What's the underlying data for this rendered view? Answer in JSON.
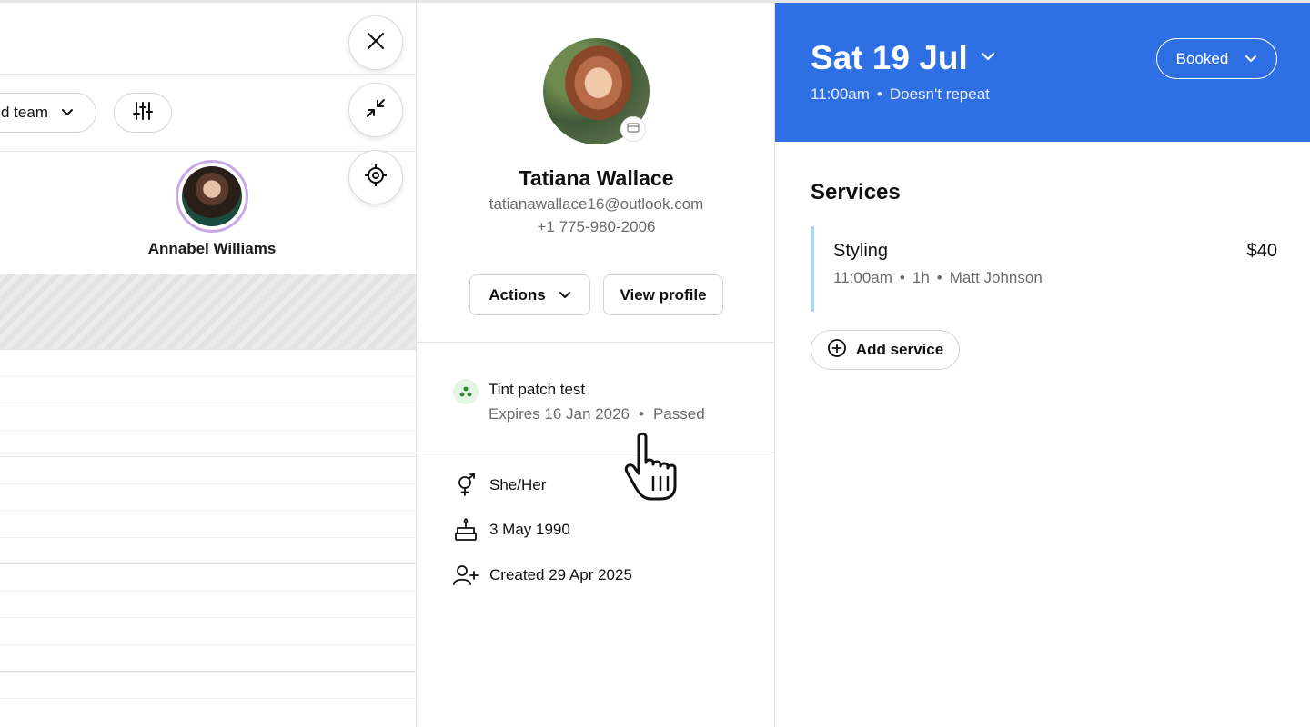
{
  "calendar": {
    "team_filter_label": "d team",
    "staff_member": {
      "name": "Annabel Williams"
    }
  },
  "client": {
    "name": "Tatiana Wallace",
    "email": "tatianawallace16@outlook.com",
    "phone": "+1 775-980-2006",
    "actions_label": "Actions",
    "view_profile_label": "View profile",
    "patch_test": {
      "title": "Tint patch test",
      "expires": "Expires 16 Jan 2026",
      "separator": "•",
      "status": "Passed"
    },
    "pronouns": "She/Her",
    "birthday": "3 May 1990",
    "created": "Created 29 Apr 2025"
  },
  "appointment": {
    "date": "Sat 19 Jul",
    "time": "11:00am",
    "separator": "•",
    "repeat": "Doesn't repeat",
    "status": "Booked",
    "services_title": "Services",
    "services": [
      {
        "name": "Styling",
        "price": "$40",
        "time": "11:00am",
        "duration": "1h",
        "staff": "Matt Johnson"
      }
    ],
    "add_service_label": "Add service"
  },
  "colors": {
    "header_blue": "#2f6fe4",
    "service_accent": "#a8dbef",
    "staff_ring": "#c9a8e8",
    "patch_green": "#2e8b2e"
  }
}
